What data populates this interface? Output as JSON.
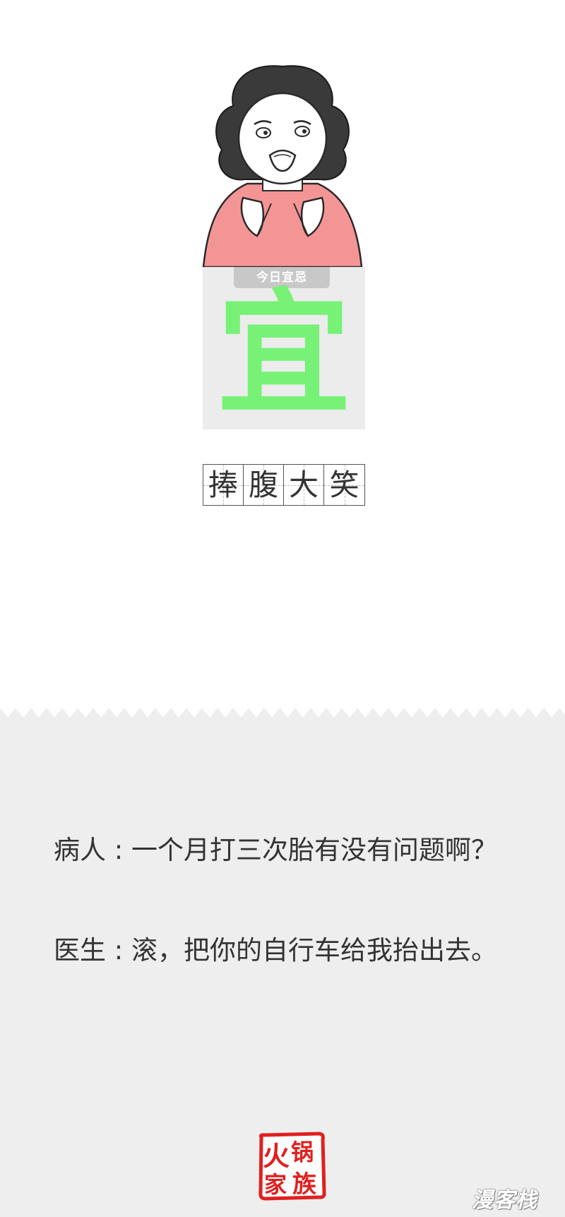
{
  "card": {
    "tag": "今日宜忌",
    "verdict": "宜",
    "verdict_color": "#77f277"
  },
  "character_image": "cartoon-woman-worried-face-pink-shirt",
  "idiom": [
    "捧",
    "腹",
    "大",
    "笑"
  ],
  "dialogue": {
    "line1": {
      "speaker": "病人",
      "text": "一个月打三次胎有没有问题啊？"
    },
    "line2": {
      "speaker": "医生",
      "text": "滚，把你的自行车给我抬出去。"
    }
  },
  "seal": {
    "chars": [
      "火",
      "锅",
      "家",
      "族"
    ],
    "color": "#e02020"
  },
  "watermark": "漫客栈",
  "colors": {
    "panel_background": "#eeeeee",
    "text": "#333333"
  }
}
